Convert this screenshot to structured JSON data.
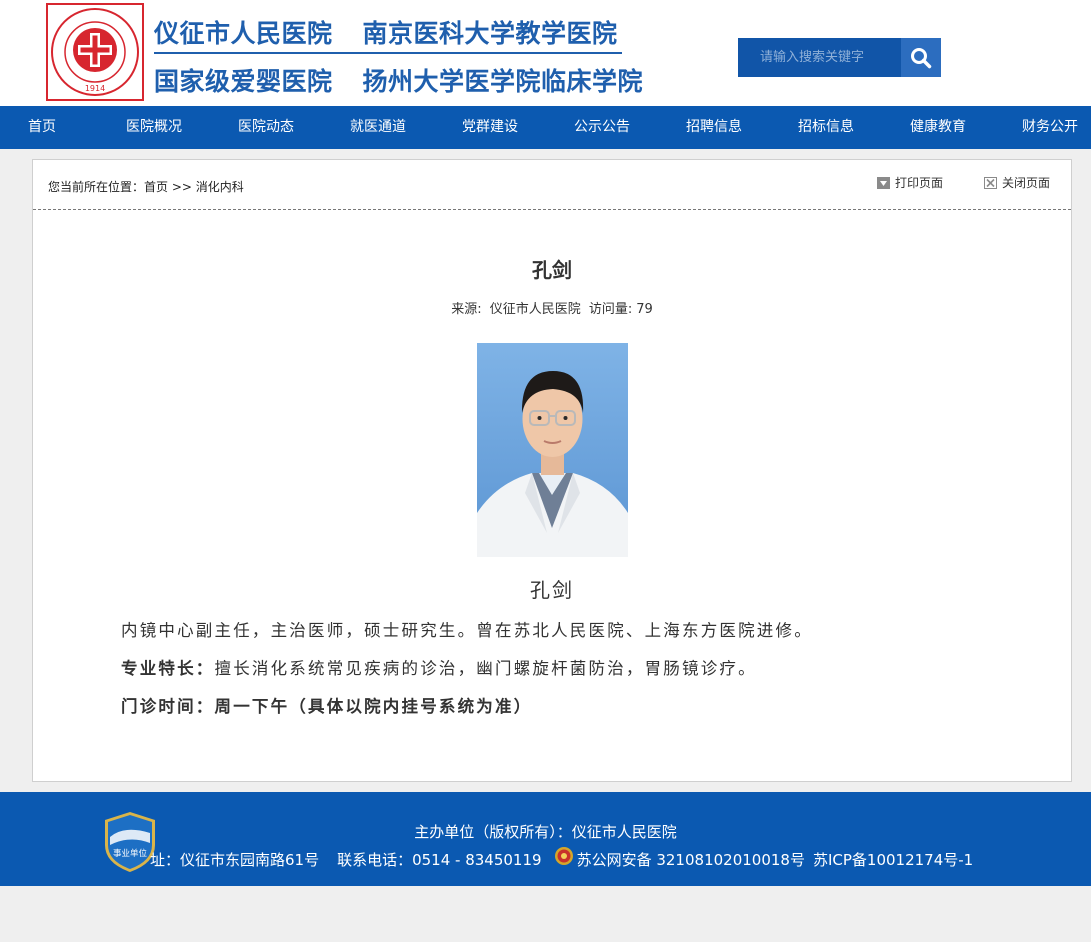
{
  "header": {
    "title_line1_a": "仪征市人民医院",
    "title_line1_b": "南京医科大学教学医院",
    "title_line2_a": "国家级爱婴医院",
    "title_line2_b": "扬州大学医学院临床学院",
    "logo_year": "1914",
    "search_placeholder": "请输入搜索关键字",
    "brand_color": "#1f5fad"
  },
  "nav": {
    "items": [
      "首页",
      "医院概况",
      "医院动态",
      "就医通道",
      "党群建设",
      "公示公告",
      "招聘信息",
      "招标信息",
      "健康教育",
      "财务公开"
    ],
    "bg_color": "#0b59b1"
  },
  "breadcrumb": {
    "prefix": "您当前所在位置：",
    "home": "首页",
    "sep": ">>",
    "current": "消化内科"
  },
  "tools": {
    "print": "打印页面",
    "close": "关闭页面"
  },
  "article": {
    "title": "孔剑",
    "source_label": "来源:",
    "source_value": "仪征市人民医院",
    "visits_label": "访问量:",
    "visits_value": "79",
    "name": "孔剑",
    "intro": "内镜中心副主任，主治医师，硕士研究生。曾在苏北人民医院、上海东方医院进修。",
    "specialty_label": "专业特长：",
    "specialty_value": "擅长消化系统常见疾病的诊治，幽门螺旋杆菌防治，胃肠镜诊疗。",
    "clinic_label": "门诊时间：周一下午（具体以院内挂号系统为准）"
  },
  "footer": {
    "line1": "主办单位（版权所有）：仪征市人民医院",
    "address": "址：仪征市东园南路61号",
    "phone": "联系电话：0514 - 83450119",
    "police": "苏公网安备 32108102010018号",
    "icp": "苏ICP备10012174号-1",
    "badge_text": "事业单位"
  }
}
